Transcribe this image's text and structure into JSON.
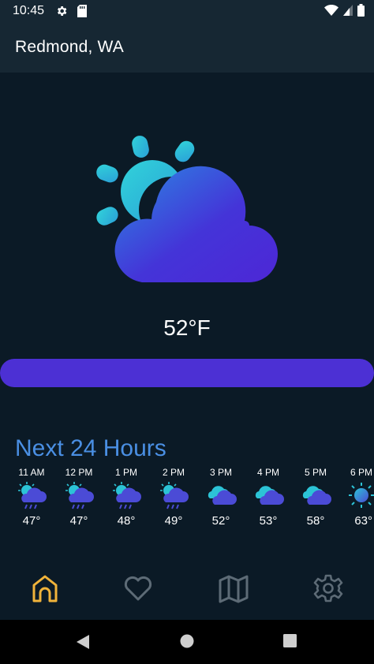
{
  "status": {
    "time": "10:45"
  },
  "header": {
    "title": "Redmond, WA"
  },
  "current": {
    "temperature": "52°F",
    "condition_icon": "partly-cloudy-icon",
    "bar_fill": 1.0
  },
  "forecast": {
    "title": "Next 24 Hours",
    "hours": [
      {
        "time": "11 AM",
        "temp": "47°",
        "icon": "rain-icon"
      },
      {
        "time": "12 PM",
        "temp": "47°",
        "icon": "rain-icon"
      },
      {
        "time": "1 PM",
        "temp": "48°",
        "icon": "rain-icon"
      },
      {
        "time": "2 PM",
        "temp": "49°",
        "icon": "rain-icon"
      },
      {
        "time": "3 PM",
        "temp": "52°",
        "icon": "cloudy-icon"
      },
      {
        "time": "4 PM",
        "temp": "53°",
        "icon": "cloudy-icon"
      },
      {
        "time": "5 PM",
        "temp": "58°",
        "icon": "cloudy-icon"
      },
      {
        "time": "6 PM",
        "temp": "63°",
        "icon": "sun-icon"
      }
    ]
  },
  "nav": {
    "items": [
      {
        "icon": "home-icon",
        "active": true
      },
      {
        "icon": "heart-icon",
        "active": false
      },
      {
        "icon": "map-icon",
        "active": false
      },
      {
        "icon": "gear-icon",
        "active": false
      }
    ],
    "active_color": "#f0b33a",
    "inactive_color": "#5d6b76"
  },
  "colors": {
    "accent_purple": "#4c30d4",
    "accent_blue": "#4a8fe3",
    "cyan": "#2cc3d6"
  }
}
